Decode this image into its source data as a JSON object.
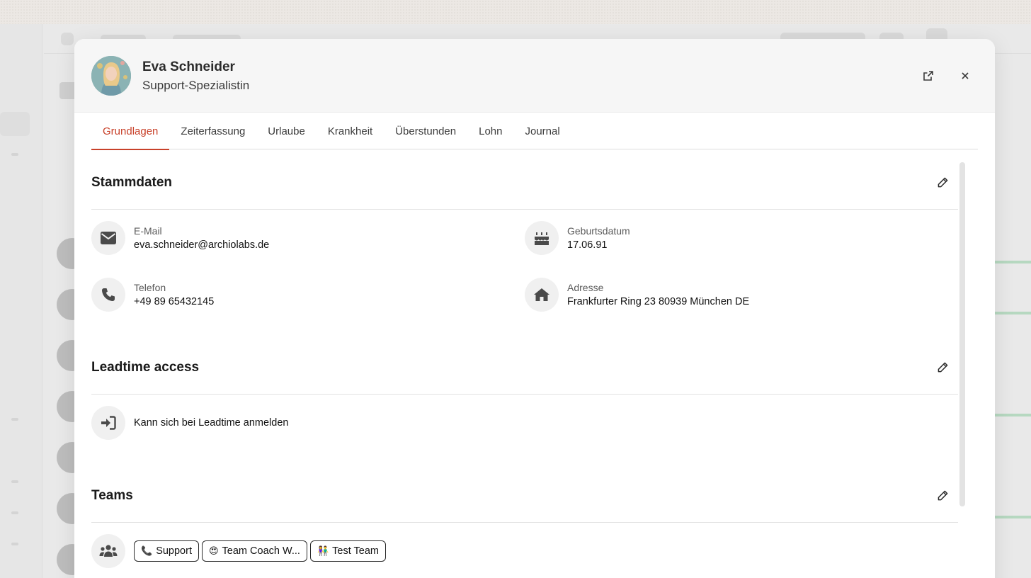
{
  "employee": {
    "name": "Eva Schneider",
    "role": "Support-Spezialistin"
  },
  "tabs": [
    {
      "label": "Grundlagen",
      "active": true
    },
    {
      "label": "Zeiterfassung",
      "active": false
    },
    {
      "label": "Urlaube",
      "active": false
    },
    {
      "label": "Krankheit",
      "active": false
    },
    {
      "label": "Überstunden",
      "active": false
    },
    {
      "label": "Lohn",
      "active": false
    },
    {
      "label": "Journal",
      "active": false
    }
  ],
  "stammdaten": {
    "title": "Stammdaten",
    "email": {
      "label": "E-Mail",
      "value": "eva.schneider@archiolabs.de",
      "icon": "envelope-icon"
    },
    "birthday": {
      "label": "Geburtsdatum",
      "value": "17.06.91",
      "icon": "cake-icon"
    },
    "phone": {
      "label": "Telefon",
      "value": "+49 89 65432145",
      "icon": "phone-icon"
    },
    "address": {
      "label": "Adresse",
      "value": "Frankfurter Ring 23 80939 München DE",
      "icon": "home-icon"
    }
  },
  "access": {
    "title": "Leadtime access",
    "text": "Kann sich bei Leadtime anmelden",
    "icon": "sign-in-icon"
  },
  "teams": {
    "title": "Teams",
    "icon": "users-icon",
    "items": [
      {
        "emoji": "📞",
        "label": "Support"
      },
      {
        "emoji": "😍",
        "label": "Team Coach W..."
      },
      {
        "emoji": "👫",
        "label": "Test Team"
      }
    ]
  },
  "colors": {
    "accent": "#c8412a",
    "header_bg": "#f6f6f6",
    "icon_circle": "#f0f0f0"
  }
}
